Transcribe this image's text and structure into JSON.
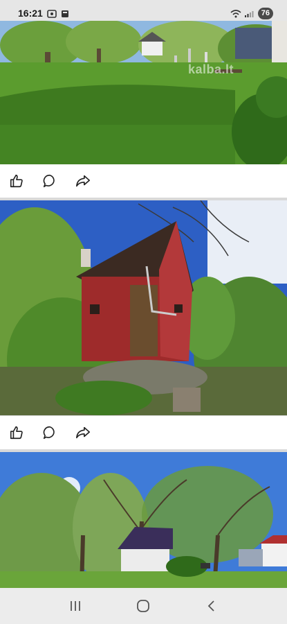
{
  "status_bar": {
    "time": "16:21",
    "battery": "76"
  },
  "watermark": {
    "text": "kalba.lt"
  },
  "photos": [
    {
      "subject": "garden lawn with fruit trees"
    },
    {
      "subject": "small red wooden shed among trees"
    },
    {
      "subject": "orchard trees with house roof"
    }
  ],
  "post_actions": {
    "like_icon": "thumbs-up-icon",
    "comment_icon": "speech-bubble-icon",
    "share_icon": "share-arrow-icon"
  },
  "nav": {
    "recent_icon": "recent-apps-icon",
    "home_icon": "home-icon",
    "back_icon": "back-icon"
  },
  "colors": {
    "sky": "#2f6fd6",
    "grass": "#4e8a2a",
    "shed_red": "#9e2b2b",
    "roof": "#3b2a22"
  }
}
